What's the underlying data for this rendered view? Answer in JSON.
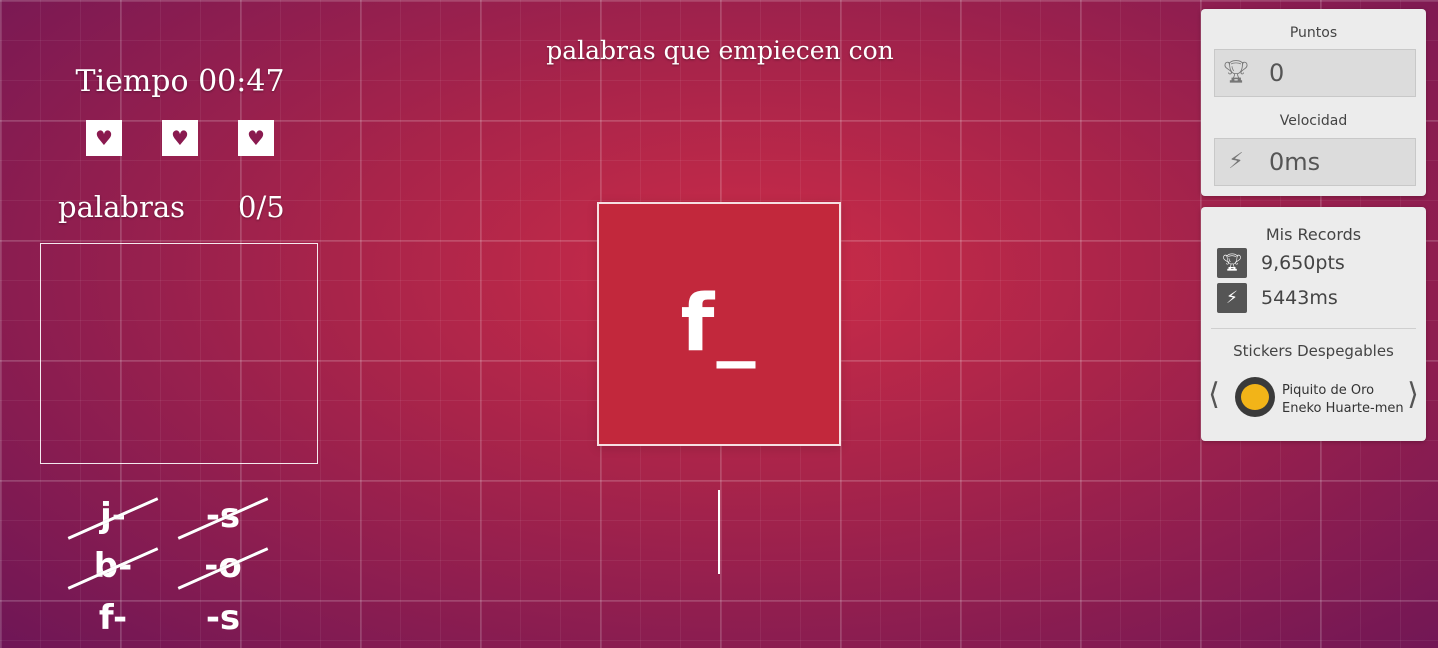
{
  "game": {
    "timer_text": "Tiempo 00:47",
    "lives": [
      "heart-icon",
      "heart-icon",
      "heart-icon"
    ],
    "words_label": "palabras",
    "words_count": "0/5",
    "prompt": "palabras que empiecen con",
    "letter": "f_",
    "hints": {
      "prefixes": [
        {
          "text": "j-",
          "struck": true
        },
        {
          "text": "b-",
          "struck": true
        },
        {
          "text": "f-",
          "struck": false
        }
      ],
      "suffixes": [
        {
          "text": "-s",
          "struck": true
        },
        {
          "text": "-o",
          "struck": true
        },
        {
          "text": "-s",
          "struck": false
        }
      ]
    }
  },
  "stats": {
    "points_title": "Puntos",
    "points_value": "0",
    "speed_title": "Velocidad",
    "speed_value": "0ms"
  },
  "records": {
    "title": "Mis Records",
    "best_points": "9,650pts",
    "best_speed": "5443ms",
    "stickers_title": "Stickers Despegables",
    "sticker_name": "Piquito de Oro",
    "sticker_author": "Eneko Huarte-men",
    "prev_arrow": "⟨",
    "next_arrow": "⟩"
  },
  "icons": {
    "trophy": "trophy-icon",
    "lightning": "lightning-icon"
  },
  "colors": {
    "background_center": "#cc2c48",
    "background_edge": "#6e1656",
    "card": "#c2283c",
    "panel": "#ececec"
  }
}
